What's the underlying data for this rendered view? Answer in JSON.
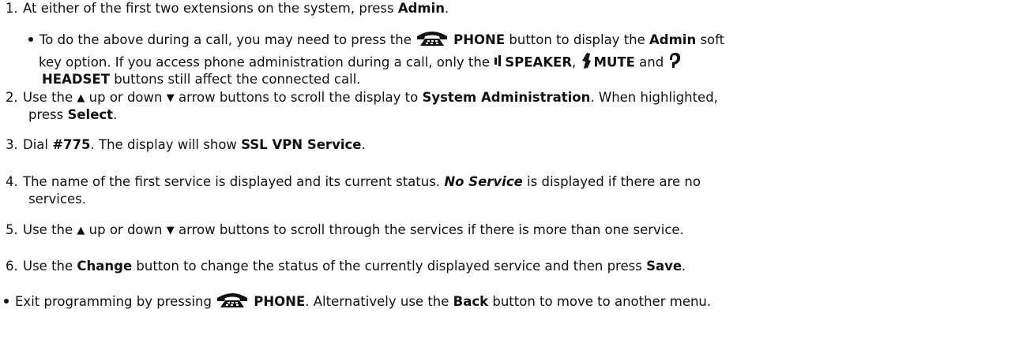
{
  "steps": [
    {
      "num": "1.",
      "pre": "At either of the first two extensions on the system, press ",
      "admin": "Admin",
      "post": "."
    },
    {
      "num": "2.",
      "pre": "Use the ",
      "up_icon": "▲",
      "mid": " up or down ",
      "down_icon": "▼",
      "post1": " arrow buttons to scroll the display to ",
      "target": "System Administration",
      "post2": ". When highlighted,",
      "line2_pre": "press ",
      "select": "Select",
      "line2_post": "."
    },
    {
      "num": "3.",
      "pre": "Dial ",
      "code": "#775",
      "mid": ". The display will show ",
      "svc": "SSL VPN Service",
      "post": "."
    },
    {
      "num": "4.",
      "pre": "The name of the first service is displayed and its current status. ",
      "noservice": "No Service",
      "post": " is displayed if there are no",
      "line2": "services."
    },
    {
      "num": "5.",
      "pre": "Use the ",
      "up_icon": "▲",
      "mid": " up or down ",
      "down_icon": "▼",
      "post": " arrow buttons to scroll through the services if there is more than one service."
    },
    {
      "num": "6.",
      "pre": "Use the ",
      "change": "Change",
      "mid": " button to change the status of the currently displayed service and then press ",
      "save": "Save",
      "post": "."
    }
  ],
  "sub_bullet": {
    "pre": "To do the above during a call, you may need to press the ",
    "phone": "PHONE",
    "mid": " button to display the ",
    "admin": "Admin",
    "post": " soft",
    "line2_pre": "key option. If you access phone administration during a call, only the ",
    "speaker": "SPEAKER",
    "comma": ", ",
    "mute": "MUTE",
    "and": " and ",
    "headset": "HEADSET",
    "line3_post": " buttons still affect the connected call."
  },
  "exit_bullet": {
    "pre": "Exit programming by pressing ",
    "phone": "PHONE",
    "mid": ". Alternatively use the ",
    "back": "Back",
    "post": " button to move to another menu."
  },
  "icons": {
    "phone": "phone-handset-icon",
    "speaker": "speaker-icon",
    "mute": "mute-icon",
    "headset": "headset-icon"
  }
}
